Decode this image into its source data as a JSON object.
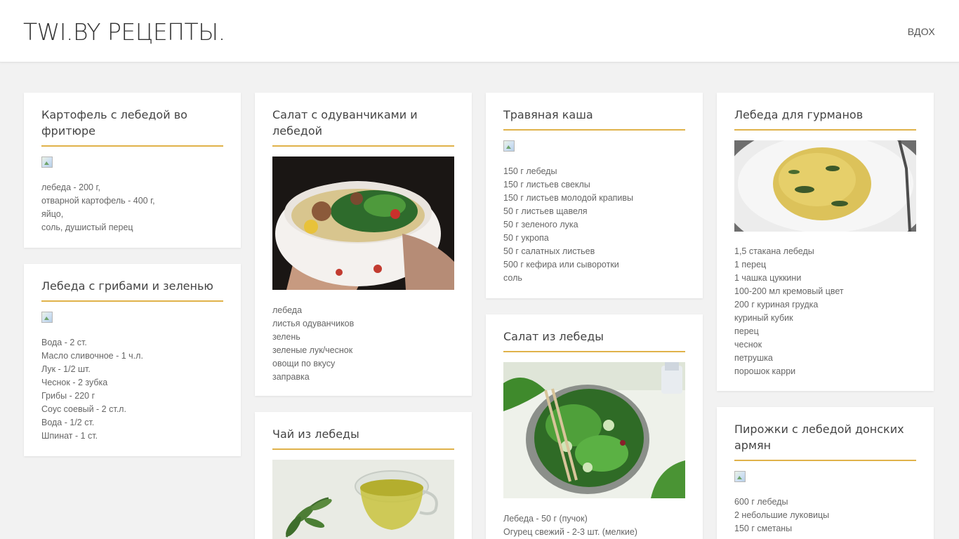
{
  "header": {
    "brand": "TWI.BY РЕЦЕПТЫ.",
    "login": "ВДОХ"
  },
  "recipes": [
    {
      "title": "Картофель с лебедой во фритюре",
      "ingredients": [
        "лебеда - 200 г,",
        "отварной картофель - 400 г,",
        "яйцо,",
        "соль, душистый перец"
      ]
    },
    {
      "title": "Лебеда с грибами и зеленью",
      "ingredients": [
        "Вода - 2 ст.",
        "Масло сливочное - 1 ч.л.",
        "Лук - 1/2 шт.",
        "Чеснок - 2 зубка",
        "Грибы - 220 г",
        "Соус соевый - 2 ст.л.",
        "Вода - 1/2 ст.",
        "Шпинат - 1 ст."
      ]
    },
    {
      "title": "Салат с одуванчиками и лебедой",
      "ingredients": [
        "лебеда",
        "листья одуванчиков",
        "зелень",
        "зеленые лук/чеснок",
        "овощи по вкусу",
        "заправка"
      ]
    },
    {
      "title": "Чай из лебеды",
      "ingredients": []
    },
    {
      "title": "Травяная каша",
      "ingredients": [
        "150 г лебеды",
        "150 г листьев свеклы",
        "150 г листьев молодой крапивы",
        "50 г листьев щавеля",
        "50 г зеленого лука",
        "50 г укропа",
        "50 г салатных листьев",
        "500 г кефира или сыворотки",
        "соль"
      ]
    },
    {
      "title": "Салат из лебеды",
      "ingredients": [
        "Лебеда - 50 г (пучок)",
        "Огурец свежий - 2-3 шт. (мелкие)"
      ]
    },
    {
      "title": "Лебеда для гурманов",
      "ingredients": [
        "1,5 стакана лебеды",
        "1 перец",
        "1 чашка цуккини",
        "100-200 мл кремовый цвет",
        "200 г куриная грудка",
        "куриный кубик",
        "перец",
        "чеснок",
        "петрушка",
        "порошок карри"
      ]
    },
    {
      "title": "Пирожки с лебедой донских армян",
      "ingredients": [
        "600 г лебеды",
        "2 небольшие луковицы",
        "150 г сметаны"
      ]
    }
  ],
  "colors": {
    "accent": "#e0b24a",
    "background": "#f2f2f2",
    "card": "#ffffff"
  }
}
